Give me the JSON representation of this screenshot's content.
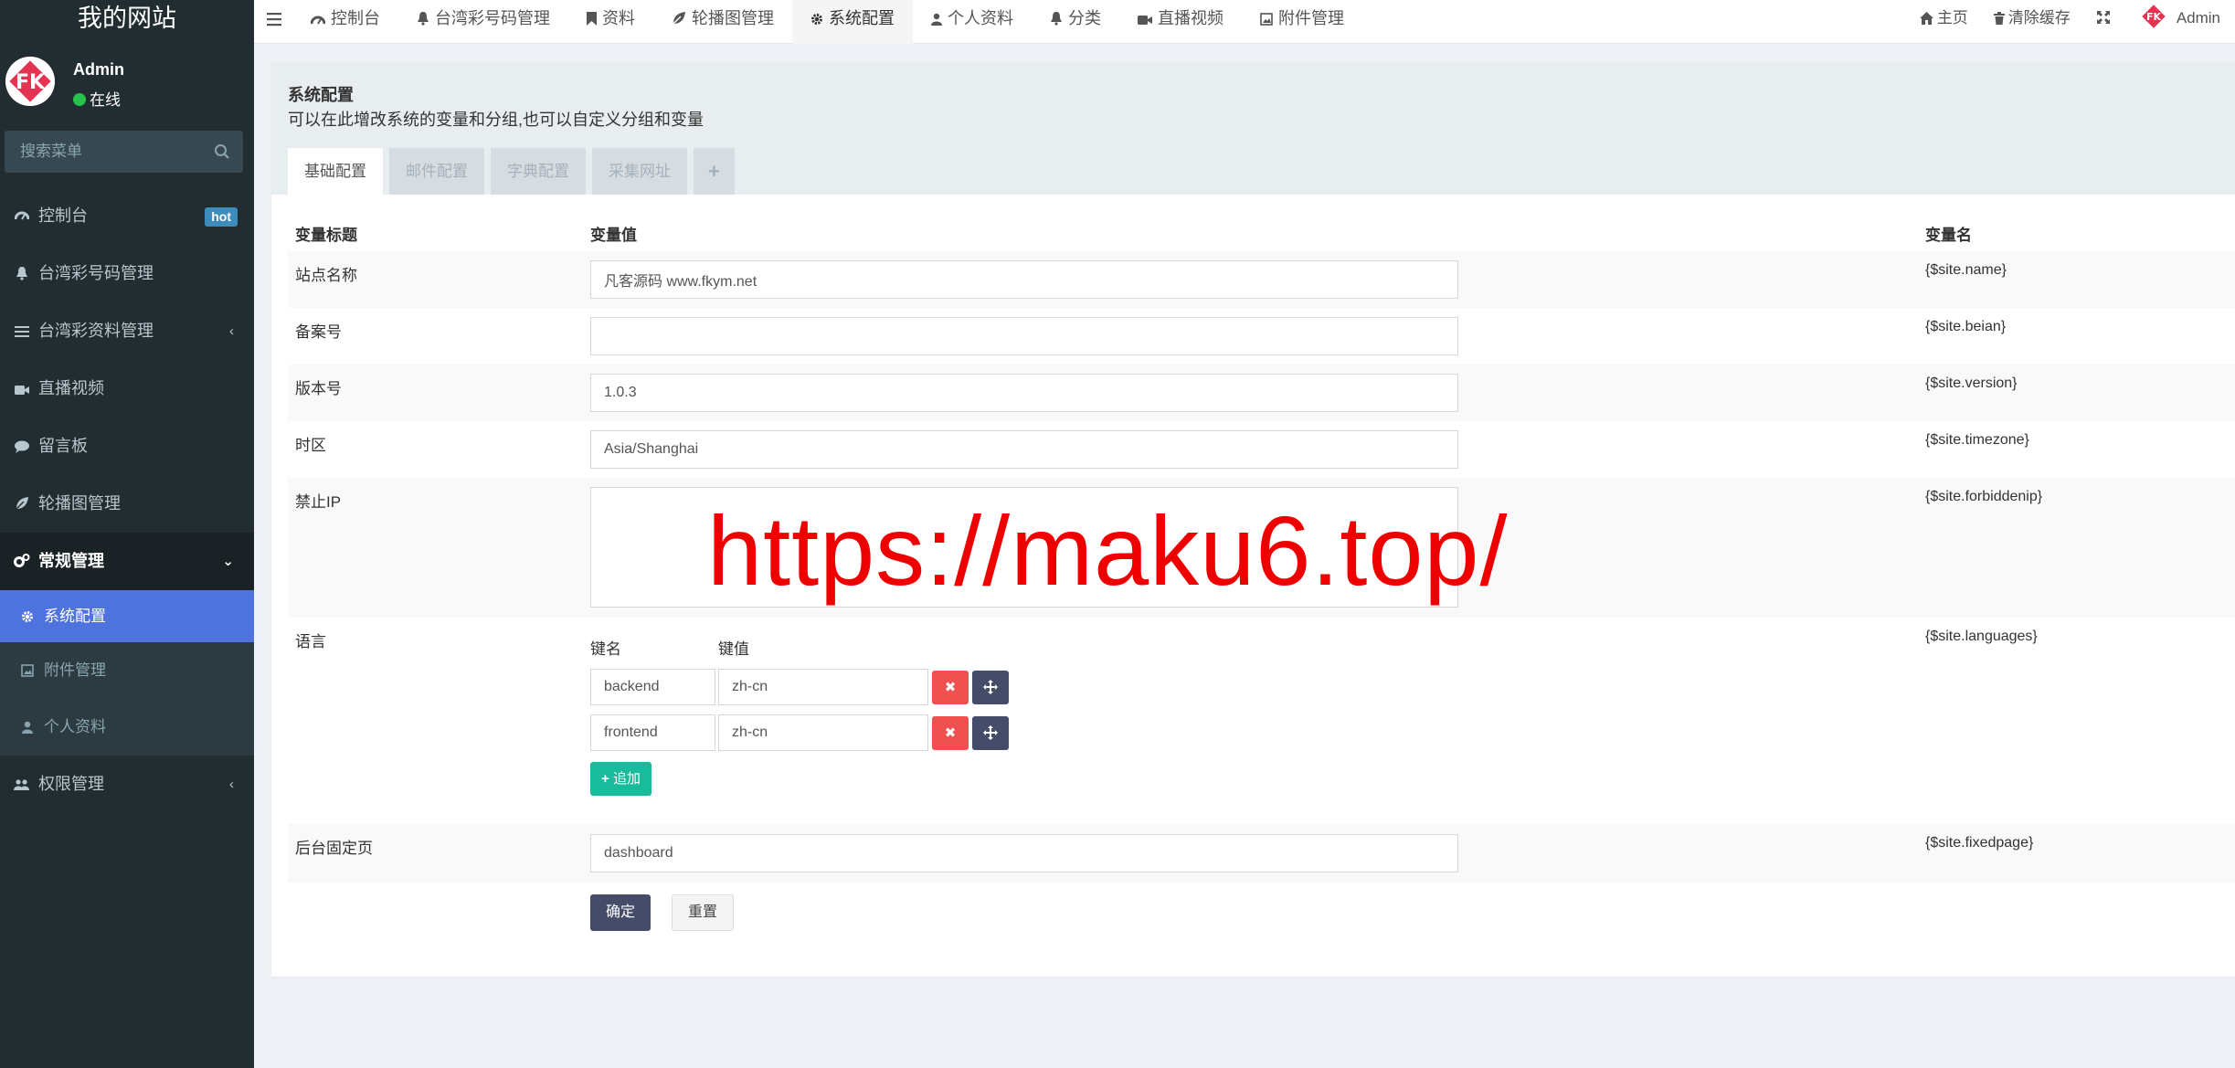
{
  "brand": {
    "title": "我的网站"
  },
  "user": {
    "name": "Admin",
    "status": "在线"
  },
  "search": {
    "placeholder": "搜索菜单"
  },
  "sidebar": {
    "items": [
      {
        "label": "控制台",
        "icon": "dashboard-icon",
        "badge": "hot"
      },
      {
        "label": "台湾彩号码管理",
        "icon": "bell-icon"
      },
      {
        "label": "台湾彩资料管理",
        "icon": "list-icon"
      },
      {
        "label": "直播视频",
        "icon": "video-icon"
      },
      {
        "label": "留言板",
        "icon": "comment-icon"
      },
      {
        "label": "轮播图管理",
        "icon": "leaf-icon"
      },
      {
        "label": "常规管理",
        "icon": "cogs-icon"
      },
      {
        "label": "权限管理",
        "icon": "users-icon"
      }
    ],
    "submenu": [
      {
        "label": "系统配置",
        "icon": "gear-icon"
      },
      {
        "label": "附件管理",
        "icon": "image-icon"
      },
      {
        "label": "个人资料",
        "icon": "user-icon"
      }
    ]
  },
  "topbar": {
    "tabs": [
      {
        "label": "控制台"
      },
      {
        "label": "台湾彩号码管理"
      },
      {
        "label": "资料"
      },
      {
        "label": "轮播图管理"
      },
      {
        "label": "系统配置"
      },
      {
        "label": "个人资料"
      },
      {
        "label": "分类"
      },
      {
        "label": "直播视频"
      },
      {
        "label": "附件管理"
      }
    ],
    "right": {
      "home": "主页",
      "clear_cache": "清除缓存",
      "admin": "Admin"
    }
  },
  "page": {
    "title": "系统配置",
    "description": "可以在此增改系统的变量和分组,也可以自定义分组和变量",
    "tabs": [
      "基础配置",
      "邮件配置",
      "字典配置",
      "采集网址"
    ],
    "add_tab": "+"
  },
  "table": {
    "headers": {
      "title": "变量标题",
      "value": "变量值",
      "name": "变量名"
    },
    "rows": [
      {
        "label": "站点名称",
        "value": "凡客源码 www.fkym.net",
        "var": "{$site.name}"
      },
      {
        "label": "备案号",
        "value": "",
        "var": "{$site.beian}"
      },
      {
        "label": "版本号",
        "value": "1.0.3",
        "var": "{$site.version}"
      },
      {
        "label": "时区",
        "value": "Asia/Shanghai",
        "var": "{$site.timezone}"
      },
      {
        "label": "禁止IP",
        "value": "",
        "var": "{$site.forbiddenip}"
      },
      {
        "label": "语言",
        "var": "{$site.languages}"
      },
      {
        "label": "后台固定页",
        "value": "dashboard",
        "var": "{$site.fixedpage}"
      }
    ],
    "languages": {
      "key_header": "键名",
      "value_header": "键值",
      "pairs": [
        {
          "key": "backend",
          "value": "zh-cn"
        },
        {
          "key": "frontend",
          "value": "zh-cn"
        }
      ],
      "add_label": "追加"
    }
  },
  "buttons": {
    "confirm": "确定",
    "reset": "重置"
  },
  "watermark": "https://maku6.top/",
  "colors": {
    "sidebar_bg": "#222d32",
    "active_menu": "#4e73df",
    "delete": "#f05050",
    "move": "#444c69",
    "add": "#18bc9c",
    "badge": "#3c8dbc",
    "watermark": "#ee0000"
  }
}
